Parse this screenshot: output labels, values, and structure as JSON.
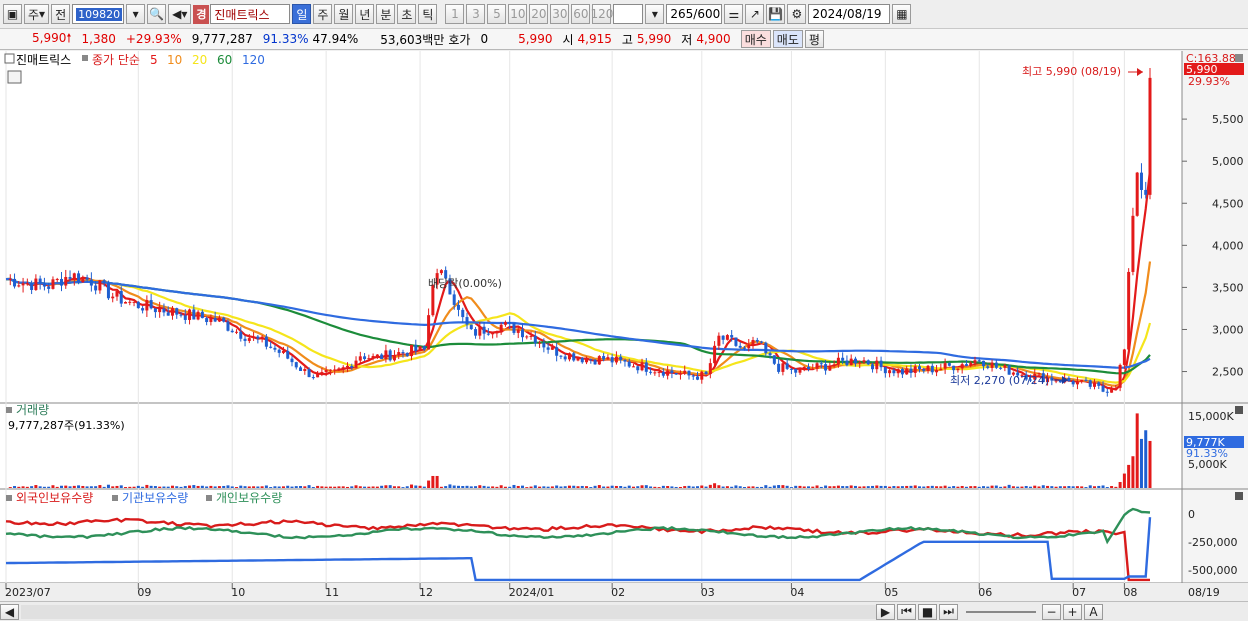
{
  "toolbar": {
    "period_label": "주",
    "prev_label": "전",
    "code": "109820",
    "market_tag": "경",
    "stock_name": "진매트릭스",
    "periods": [
      "일",
      "주",
      "월",
      "년",
      "분",
      "초",
      "틱"
    ],
    "active_period": "일",
    "intervals": [
      "1",
      "3",
      "5",
      "10",
      "20",
      "30",
      "60",
      "120"
    ],
    "count_value": "265",
    "count_max": "/600",
    "date": "2024/08/19"
  },
  "info": {
    "price": "5,990",
    "change": "1,380",
    "change_pct": "+29.93%",
    "volume": "9,777,287",
    "volume_ratio": "91.33%",
    "turnover": "47.94%",
    "amount": "53,603백만",
    "quote_label": "호가",
    "quote_value": "0",
    "quote_price": "5,990",
    "open_label": "시",
    "open": "4,915",
    "high_label": "고",
    "high": "5,990",
    "low_label": "저",
    "low": "4,900",
    "buy_label": "매수",
    "sell_label": "매도",
    "avg_label": "평"
  },
  "price_panel": {
    "name": "진매트릭스",
    "ma_label": "종가 단순",
    "ma_periods": [
      "5",
      "10",
      "20",
      "60",
      "120"
    ],
    "ma_colors": [
      "#e31a1a",
      "#f08c1c",
      "#f5e51b",
      "#1c8c3a",
      "#2f6be0"
    ],
    "high_note": "최고 5,990 (08/19)",
    "low_note": "최저 2,270 (07/24)",
    "dividend_note": "배당락(0.00%)",
    "axis_top": "C:163.88",
    "current_price_tag": "5,990",
    "current_pct_tag": "29.93%",
    "yticks": [
      "5,500",
      "5,000",
      "4,500",
      "4,000",
      "3,500",
      "3,000",
      "2,500"
    ]
  },
  "volume_panel": {
    "title": "거래량",
    "readout": "9,777,287주(91.33%)",
    "yticks": [
      "15,000K",
      "5,000K"
    ],
    "current_tag": "9,777K",
    "current_pct": "91.33%"
  },
  "holding_panel": {
    "series": [
      "외국인보유수량",
      "기관보유수량",
      "개인보유수량"
    ],
    "colors": [
      "#d81b1b",
      "#2f6be0",
      "#2e9059"
    ],
    "yticks": [
      "0",
      "-250,000",
      "-500,000"
    ]
  },
  "xaxis": {
    "labels": [
      "2023/07",
      "09",
      "10",
      "11",
      "12",
      "2024/01",
      "02",
      "03",
      "04",
      "05",
      "06",
      "07",
      "08"
    ],
    "end_label": "08/19"
  },
  "chart_data": {
    "type": "candlestick",
    "title": "진매트릭스",
    "price_range": [
      2150,
      6250
    ],
    "months": [
      "2023/07",
      "08",
      "09",
      "10",
      "11",
      "12",
      "2024/01",
      "02",
      "03",
      "04",
      "05",
      "06",
      "07",
      "08"
    ],
    "close_trend": [
      [
        0,
        3600
      ],
      [
        5,
        3550
      ],
      [
        10,
        3520
      ],
      [
        15,
        3650
      ],
      [
        20,
        3580
      ],
      [
        25,
        3400
      ],
      [
        30,
        3300
      ],
      [
        35,
        3250
      ],
      [
        40,
        3200
      ],
      [
        45,
        3150
      ],
      [
        50,
        3100
      ],
      [
        55,
        2950
      ],
      [
        60,
        2850
      ],
      [
        65,
        2700
      ],
      [
        70,
        2500
      ],
      [
        73,
        2440
      ],
      [
        77,
        2480
      ],
      [
        80,
        2560
      ],
      [
        83,
        2700
      ],
      [
        86,
        2660
      ],
      [
        90,
        2700
      ],
      [
        95,
        2750
      ],
      [
        98,
        2750
      ],
      [
        100,
        3600
      ],
      [
        103,
        3650
      ],
      [
        106,
        3200
      ],
      [
        109,
        2950
      ],
      [
        112,
        3000
      ],
      [
        116,
        3050
      ],
      [
        120,
        3000
      ],
      [
        124,
        2900
      ],
      [
        128,
        2750
      ],
      [
        132,
        2700
      ],
      [
        136,
        2650
      ],
      [
        140,
        2650
      ],
      [
        145,
        2600
      ],
      [
        150,
        2550
      ],
      [
        155,
        2500
      ],
      [
        160,
        2450
      ],
      [
        164,
        2450
      ],
      [
        167,
        2900
      ],
      [
        170,
        2850
      ],
      [
        173,
        2750
      ],
      [
        176,
        2850
      ],
      [
        178,
        2700
      ],
      [
        181,
        2550
      ],
      [
        185,
        2500
      ],
      [
        190,
        2550
      ],
      [
        195,
        2600
      ],
      [
        200,
        2650
      ],
      [
        205,
        2550
      ],
      [
        210,
        2500
      ],
      [
        215,
        2520
      ],
      [
        220,
        2550
      ],
      [
        225,
        2600
      ],
      [
        228,
        2650
      ],
      [
        232,
        2550
      ],
      [
        236,
        2500
      ],
      [
        240,
        2450
      ],
      [
        245,
        2420
      ],
      [
        250,
        2380
      ],
      [
        255,
        2320
      ],
      [
        257,
        2270
      ],
      [
        260,
        2350
      ],
      [
        262,
        2750
      ],
      [
        263,
        3600
      ],
      [
        264,
        4400
      ],
      [
        265,
        4900
      ],
      [
        266,
        4700
      ],
      [
        267,
        4600
      ],
      [
        268,
        5990
      ]
    ],
    "high": 5990,
    "high_date": "08/19",
    "low": 2270,
    "low_date": "07/24",
    "last": {
      "open": 4915,
      "high": 5990,
      "low": 4900,
      "close": 5990,
      "volume": 9777287,
      "change": 1380,
      "change_pct": 29.93
    }
  }
}
